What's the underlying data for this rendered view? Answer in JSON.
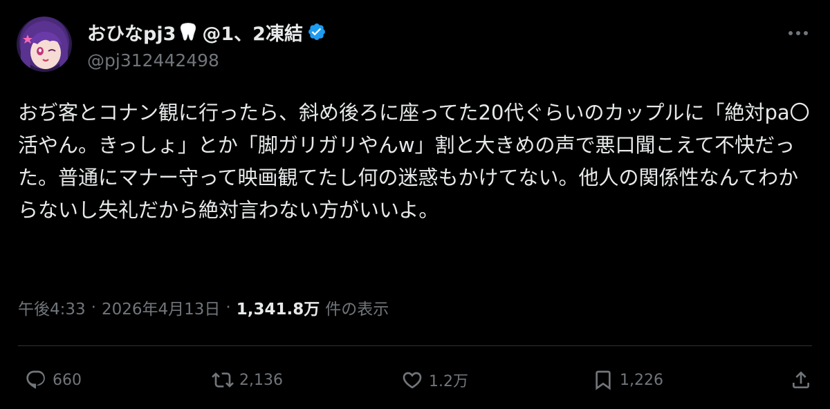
{
  "user": {
    "display_name": "おひなpj3",
    "name_suffix": "@1、2凍結",
    "handle": "@pj312442498",
    "verified_color": "#1d9bf0"
  },
  "tweet": {
    "text": "おぢ客とコナン観に行ったら、斜め後ろに座ってた20代ぐらいのカップルに「絶対pa〇活やん。きっしょ」とか「脚ガリガリやんw」割と大きめの声で悪口聞こえて不快だった。普通にマナー守って映画観てたし何の迷惑もかけてない。他人の関係性なんてわからないし失礼だから絶対言わない方がいいよ。"
  },
  "meta": {
    "time": "午後4:33",
    "separator": "·",
    "date": "2026年4月13日",
    "views_count": "1,341.8万",
    "views_label": "件の表示"
  },
  "actions": {
    "reply_count": "660",
    "retweet_count": "2,136",
    "like_count": "1.2万",
    "bookmark_count": "1,226"
  },
  "icons": {
    "avatar": "avatar-image",
    "tooth": "tooth-emoji-icon",
    "verified": "verified-badge-icon",
    "more": "more-icon",
    "reply": "reply-icon",
    "retweet": "retweet-icon",
    "like": "heart-icon",
    "bookmark": "bookmark-icon",
    "share": "share-icon"
  },
  "colors": {
    "background": "#000000",
    "text_primary": "#e7e9ea",
    "text_secondary": "#71767b",
    "divider": "#2f3336",
    "accent": "#1d9bf0"
  }
}
